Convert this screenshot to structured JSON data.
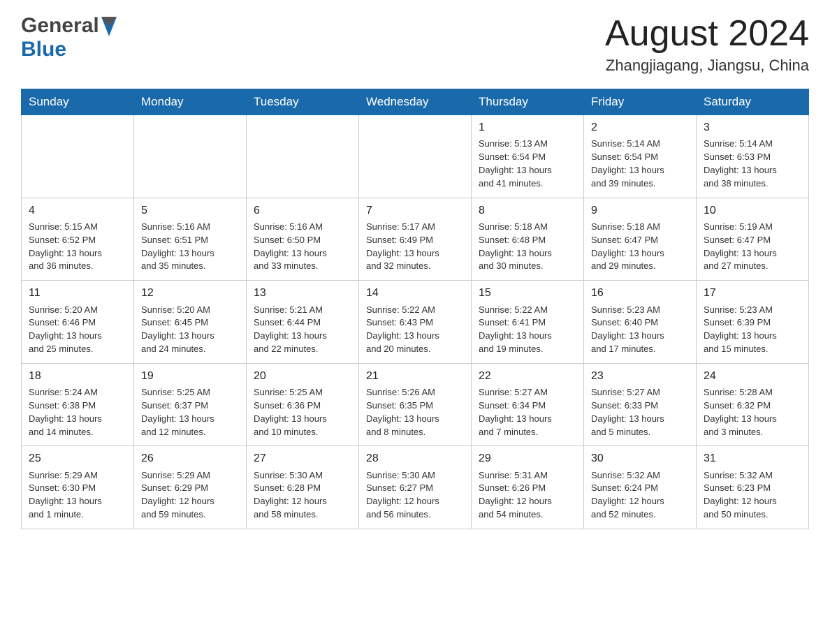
{
  "header": {
    "logo_general": "General",
    "logo_blue": "Blue",
    "month_title": "August 2024",
    "location": "Zhangjiagang, Jiangsu, China"
  },
  "weekdays": [
    "Sunday",
    "Monday",
    "Tuesday",
    "Wednesday",
    "Thursday",
    "Friday",
    "Saturday"
  ],
  "weeks": [
    [
      {
        "day": "",
        "info": ""
      },
      {
        "day": "",
        "info": ""
      },
      {
        "day": "",
        "info": ""
      },
      {
        "day": "",
        "info": ""
      },
      {
        "day": "1",
        "info": "Sunrise: 5:13 AM\nSunset: 6:54 PM\nDaylight: 13 hours\nand 41 minutes."
      },
      {
        "day": "2",
        "info": "Sunrise: 5:14 AM\nSunset: 6:54 PM\nDaylight: 13 hours\nand 39 minutes."
      },
      {
        "day": "3",
        "info": "Sunrise: 5:14 AM\nSunset: 6:53 PM\nDaylight: 13 hours\nand 38 minutes."
      }
    ],
    [
      {
        "day": "4",
        "info": "Sunrise: 5:15 AM\nSunset: 6:52 PM\nDaylight: 13 hours\nand 36 minutes."
      },
      {
        "day": "5",
        "info": "Sunrise: 5:16 AM\nSunset: 6:51 PM\nDaylight: 13 hours\nand 35 minutes."
      },
      {
        "day": "6",
        "info": "Sunrise: 5:16 AM\nSunset: 6:50 PM\nDaylight: 13 hours\nand 33 minutes."
      },
      {
        "day": "7",
        "info": "Sunrise: 5:17 AM\nSunset: 6:49 PM\nDaylight: 13 hours\nand 32 minutes."
      },
      {
        "day": "8",
        "info": "Sunrise: 5:18 AM\nSunset: 6:48 PM\nDaylight: 13 hours\nand 30 minutes."
      },
      {
        "day": "9",
        "info": "Sunrise: 5:18 AM\nSunset: 6:47 PM\nDaylight: 13 hours\nand 29 minutes."
      },
      {
        "day": "10",
        "info": "Sunrise: 5:19 AM\nSunset: 6:47 PM\nDaylight: 13 hours\nand 27 minutes."
      }
    ],
    [
      {
        "day": "11",
        "info": "Sunrise: 5:20 AM\nSunset: 6:46 PM\nDaylight: 13 hours\nand 25 minutes."
      },
      {
        "day": "12",
        "info": "Sunrise: 5:20 AM\nSunset: 6:45 PM\nDaylight: 13 hours\nand 24 minutes."
      },
      {
        "day": "13",
        "info": "Sunrise: 5:21 AM\nSunset: 6:44 PM\nDaylight: 13 hours\nand 22 minutes."
      },
      {
        "day": "14",
        "info": "Sunrise: 5:22 AM\nSunset: 6:43 PM\nDaylight: 13 hours\nand 20 minutes."
      },
      {
        "day": "15",
        "info": "Sunrise: 5:22 AM\nSunset: 6:41 PM\nDaylight: 13 hours\nand 19 minutes."
      },
      {
        "day": "16",
        "info": "Sunrise: 5:23 AM\nSunset: 6:40 PM\nDaylight: 13 hours\nand 17 minutes."
      },
      {
        "day": "17",
        "info": "Sunrise: 5:23 AM\nSunset: 6:39 PM\nDaylight: 13 hours\nand 15 minutes."
      }
    ],
    [
      {
        "day": "18",
        "info": "Sunrise: 5:24 AM\nSunset: 6:38 PM\nDaylight: 13 hours\nand 14 minutes."
      },
      {
        "day": "19",
        "info": "Sunrise: 5:25 AM\nSunset: 6:37 PM\nDaylight: 13 hours\nand 12 minutes."
      },
      {
        "day": "20",
        "info": "Sunrise: 5:25 AM\nSunset: 6:36 PM\nDaylight: 13 hours\nand 10 minutes."
      },
      {
        "day": "21",
        "info": "Sunrise: 5:26 AM\nSunset: 6:35 PM\nDaylight: 13 hours\nand 8 minutes."
      },
      {
        "day": "22",
        "info": "Sunrise: 5:27 AM\nSunset: 6:34 PM\nDaylight: 13 hours\nand 7 minutes."
      },
      {
        "day": "23",
        "info": "Sunrise: 5:27 AM\nSunset: 6:33 PM\nDaylight: 13 hours\nand 5 minutes."
      },
      {
        "day": "24",
        "info": "Sunrise: 5:28 AM\nSunset: 6:32 PM\nDaylight: 13 hours\nand 3 minutes."
      }
    ],
    [
      {
        "day": "25",
        "info": "Sunrise: 5:29 AM\nSunset: 6:30 PM\nDaylight: 13 hours\nand 1 minute."
      },
      {
        "day": "26",
        "info": "Sunrise: 5:29 AM\nSunset: 6:29 PM\nDaylight: 12 hours\nand 59 minutes."
      },
      {
        "day": "27",
        "info": "Sunrise: 5:30 AM\nSunset: 6:28 PM\nDaylight: 12 hours\nand 58 minutes."
      },
      {
        "day": "28",
        "info": "Sunrise: 5:30 AM\nSunset: 6:27 PM\nDaylight: 12 hours\nand 56 minutes."
      },
      {
        "day": "29",
        "info": "Sunrise: 5:31 AM\nSunset: 6:26 PM\nDaylight: 12 hours\nand 54 minutes."
      },
      {
        "day": "30",
        "info": "Sunrise: 5:32 AM\nSunset: 6:24 PM\nDaylight: 12 hours\nand 52 minutes."
      },
      {
        "day": "31",
        "info": "Sunrise: 5:32 AM\nSunset: 6:23 PM\nDaylight: 12 hours\nand 50 minutes."
      }
    ]
  ]
}
